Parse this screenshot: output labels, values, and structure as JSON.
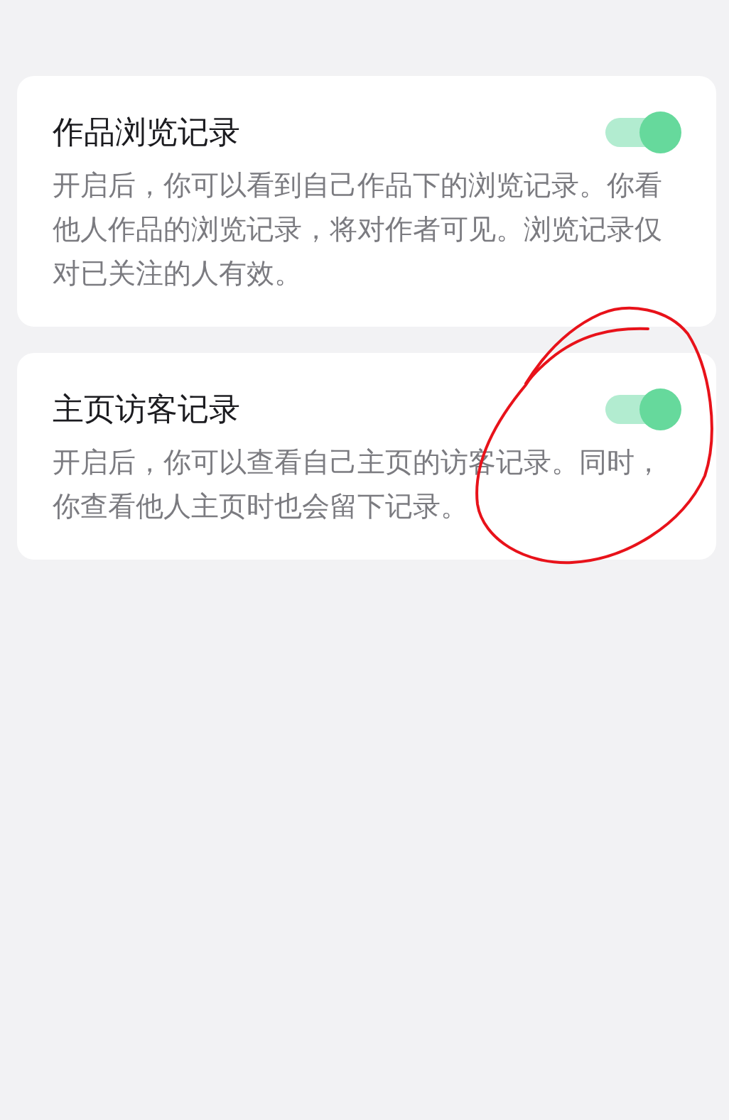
{
  "settings": [
    {
      "title": "作品浏览记录",
      "description": "开启后，你可以看到自己作品下的浏览记录。你看他人作品的浏览记录，将对作者可见。浏览记录仅对已关注的人有效。",
      "on": true
    },
    {
      "title": "主页访客记录",
      "description": "开启后，你可以查看自己主页的访客记录。同时，你查看他人主页时也会留下记录。",
      "on": true
    }
  ]
}
